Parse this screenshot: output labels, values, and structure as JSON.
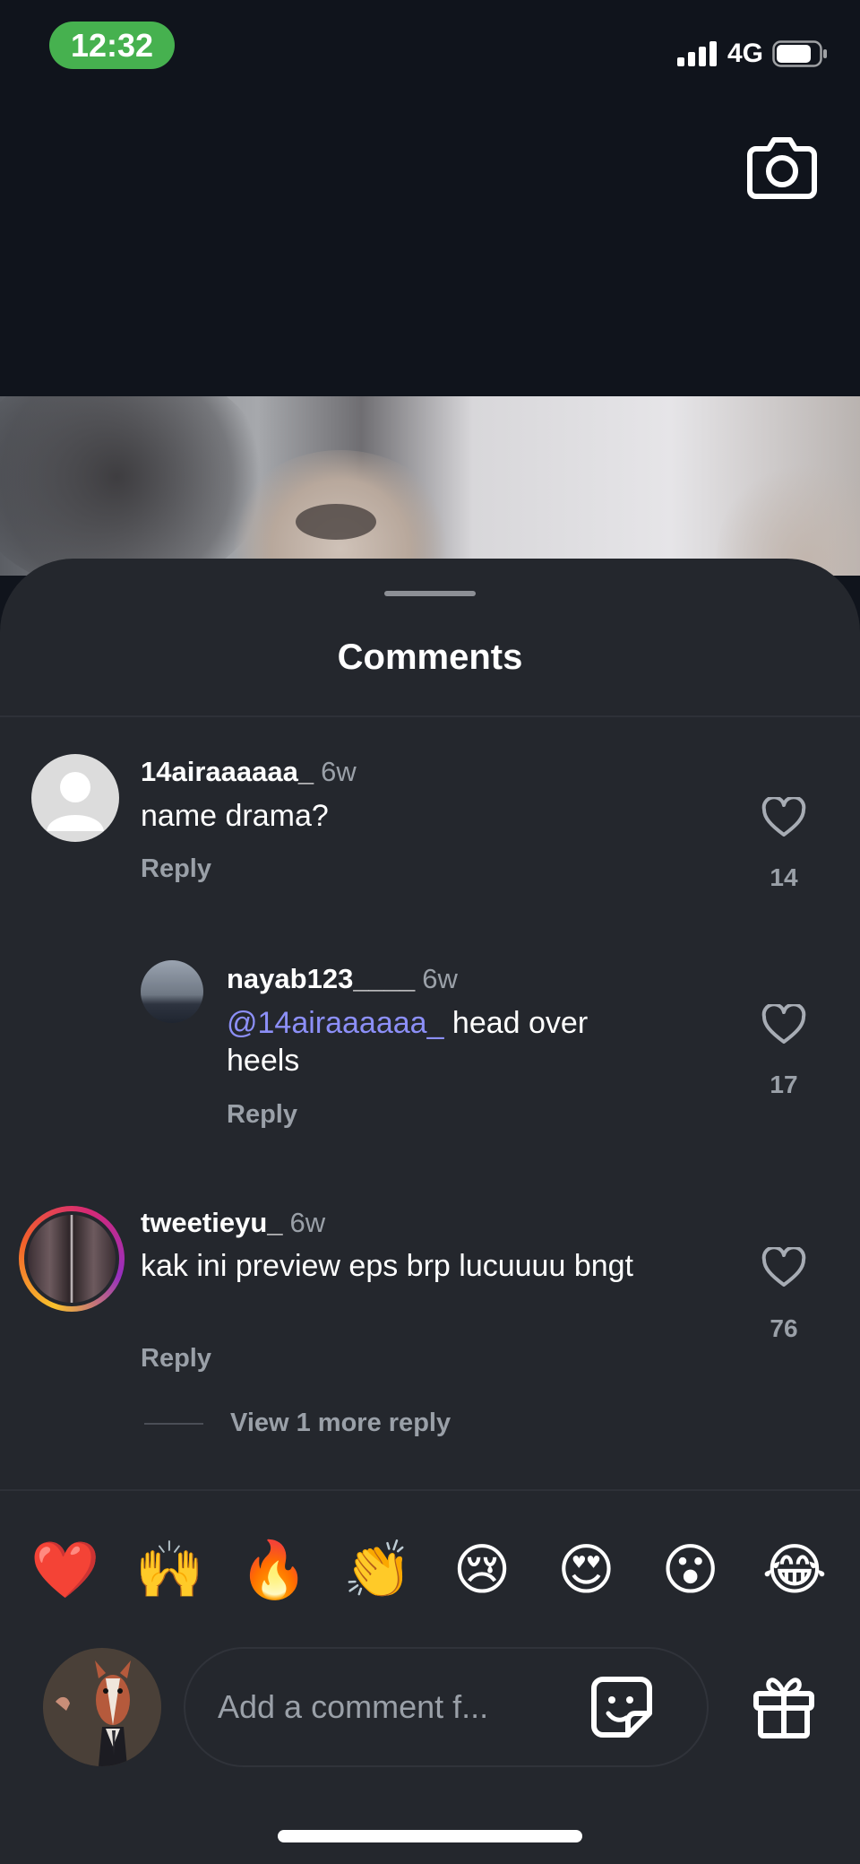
{
  "status_bar": {
    "time": "12:32",
    "network": "4G",
    "time_pill_color": "#46b14f",
    "battery_level": 0.75
  },
  "header": {
    "camera_icon": "camera-icon"
  },
  "sheet": {
    "title": "Comments",
    "background": "#24272d"
  },
  "comments": [
    {
      "username": "14airaaaaaa_",
      "time": "6w",
      "text": "name drama?",
      "reply_label": "Reply",
      "likes": "14"
    },
    {
      "username": "nayab123____",
      "time": "6w",
      "mention": "@14airaaaaaa_",
      "text": " head over heels",
      "reply_label": "Reply",
      "likes": "17"
    },
    {
      "username": "tweetieyu_",
      "time": "6w",
      "text": "kak ini preview eps brp lucuuuu bngt",
      "reply_label": "Reply",
      "likes": "76",
      "view_more": "View 1 more reply"
    }
  ],
  "reactions": [
    "❤️",
    "🙌",
    "🔥",
    "👏",
    "😢",
    "😍",
    "😮",
    "😂"
  ],
  "composer": {
    "placeholder": "Add a comment f...",
    "sticker_icon": "sticker-icon",
    "gift_icon": "gift-icon"
  },
  "colors": {
    "mention": "#8c8ff7",
    "muted": "#9aa0a8"
  }
}
